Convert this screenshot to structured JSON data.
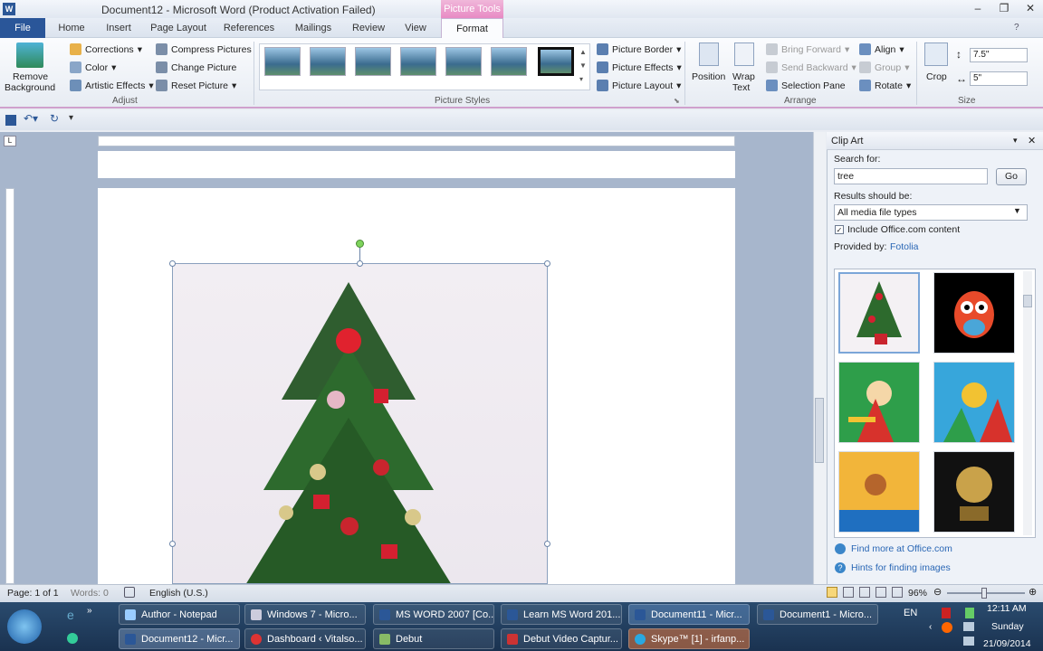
{
  "window": {
    "title": "Document12 - Microsoft Word (Product Activation Failed)",
    "app_letter": "W",
    "context_header": "Picture Tools"
  },
  "tabs": {
    "file": "File",
    "home": "Home",
    "insert": "Insert",
    "page_layout": "Page Layout",
    "references": "References",
    "mailings": "Mailings",
    "review": "Review",
    "view": "View",
    "format": "Format"
  },
  "ribbon": {
    "remove_bg_line1": "Remove",
    "remove_bg_line2": "Background",
    "corrections": "Corrections",
    "color": "Color",
    "artistic_effects": "Artistic Effects",
    "compress_pictures": "Compress Pictures",
    "change_picture": "Change Picture",
    "reset_picture": "Reset Picture",
    "adjust_label": "Adjust",
    "picture_styles_label": "Picture Styles",
    "picture_border": "Picture Border",
    "picture_effects": "Picture Effects",
    "picture_layout": "Picture Layout",
    "position": "Position",
    "wrap_line1": "Wrap",
    "wrap_line2": "Text",
    "bring_forward": "Bring Forward",
    "send_backward": "Send Backward",
    "selection_pane": "Selection Pane",
    "align": "Align",
    "group": "Group",
    "rotate": "Rotate",
    "arrange_label": "Arrange",
    "crop": "Crop",
    "height": "7.5\"",
    "width": "5\"",
    "size_label": "Size"
  },
  "clipart": {
    "title": "Clip Art",
    "search_label": "Search for:",
    "search_value": "tree",
    "go": "Go",
    "results_label": "Results should be:",
    "results_value": "All media file types",
    "include_office": "Include Office.com content",
    "provided_by": "Provided by:",
    "provider": "Fotolia",
    "find_more": "Find more at Office.com",
    "hints": "Hints for finding images"
  },
  "status": {
    "page": "Page: 1 of 1",
    "words": "Words: 0",
    "language": "English (U.S.)",
    "zoom": "96%"
  },
  "taskbar": {
    "row1": [
      "Author - Notepad",
      "Windows 7 - Micro...",
      "MS WORD 2007 [Co...",
      "Learn MS Word 201...",
      "Document11 - Micr...",
      "Document1 - Micro..."
    ],
    "row2": [
      "Document12 - Micr...",
      "Dashboard ‹ Vitalso...",
      "Debut",
      "Debut Video Captur...",
      "Skype™ [1] - irfanp..."
    ],
    "lang": "EN",
    "time": "12:11 AM",
    "day": "Sunday",
    "date": "21/09/2014"
  },
  "colors": {
    "file_tab": "#2a5699",
    "context": "#e88bc4",
    "taskbar": "#1a3250"
  }
}
